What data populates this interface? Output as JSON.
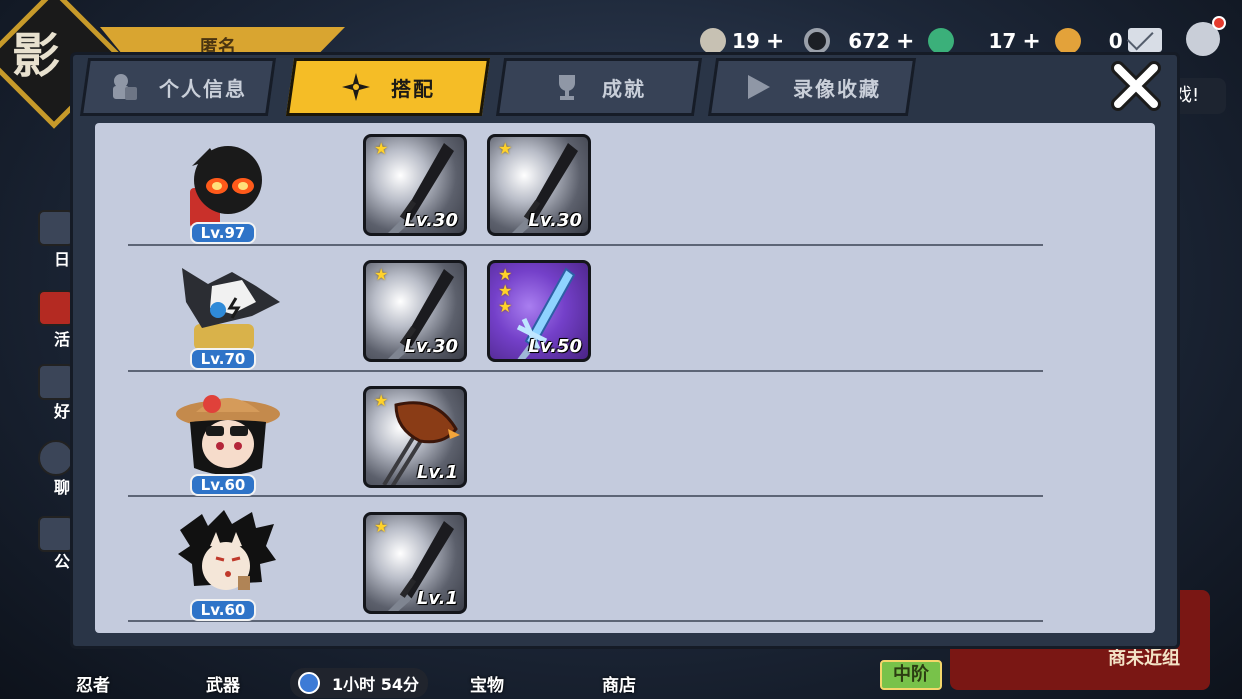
{
  "background": {
    "emblem_char": "影",
    "player_name": "匿名",
    "currencies": [
      {
        "icon": "rice-ball-icon",
        "value": "19",
        "color": "#c7c1b3"
      },
      {
        "icon": "coin-icon",
        "value": "672",
        "color": "#6f737b"
      },
      {
        "icon": "jade-icon",
        "value": "17",
        "color": "#3bb07a"
      },
      {
        "icon": "key-icon",
        "value": "0",
        "color": "#e3a23a"
      }
    ],
    "plus": "+",
    "side_menu": [
      "日",
      "活",
      "好",
      "聊",
      "公"
    ],
    "right_tag": "戏!",
    "bottom_nav": [
      "忍者",
      "武器",
      "宝物",
      "商店"
    ],
    "timer": "1小时 54分",
    "rank": "中阶",
    "banner_text": "商未近组"
  },
  "tabs": [
    {
      "label": "个人信息",
      "icon": "profile-icon",
      "active": false
    },
    {
      "label": "搭配",
      "icon": "shuriken-icon",
      "active": true
    },
    {
      "label": "成就",
      "icon": "trophy-icon",
      "active": false
    },
    {
      "label": "录像收藏",
      "icon": "play-icon",
      "active": false
    }
  ],
  "ninjas": [
    {
      "name": "shadow-ninja",
      "level": "Lv.97",
      "items": [
        {
          "kind": "katana",
          "stars": 1,
          "level": "Lv.30",
          "rarity": "gray"
        },
        {
          "kind": "katana",
          "stars": 1,
          "level": "Lv.30",
          "rarity": "gray"
        }
      ]
    },
    {
      "name": "wolf-ninja",
      "level": "Lv.70",
      "items": [
        {
          "kind": "katana",
          "stars": 1,
          "level": "Lv.30",
          "rarity": "gray"
        },
        {
          "kind": "ice-sword",
          "stars": 3,
          "level": "Lv.50",
          "rarity": "purple"
        }
      ]
    },
    {
      "name": "summer-kunoichi",
      "level": "Lv.60",
      "items": [
        {
          "kind": "sweet-potato-stick",
          "stars": 1,
          "level": "Lv.1",
          "rarity": "gray"
        }
      ]
    },
    {
      "name": "fox-mask-ninja",
      "level": "Lv.60",
      "items": [
        {
          "kind": "katana",
          "stars": 1,
          "level": "Lv.1",
          "rarity": "gray"
        }
      ]
    }
  ]
}
